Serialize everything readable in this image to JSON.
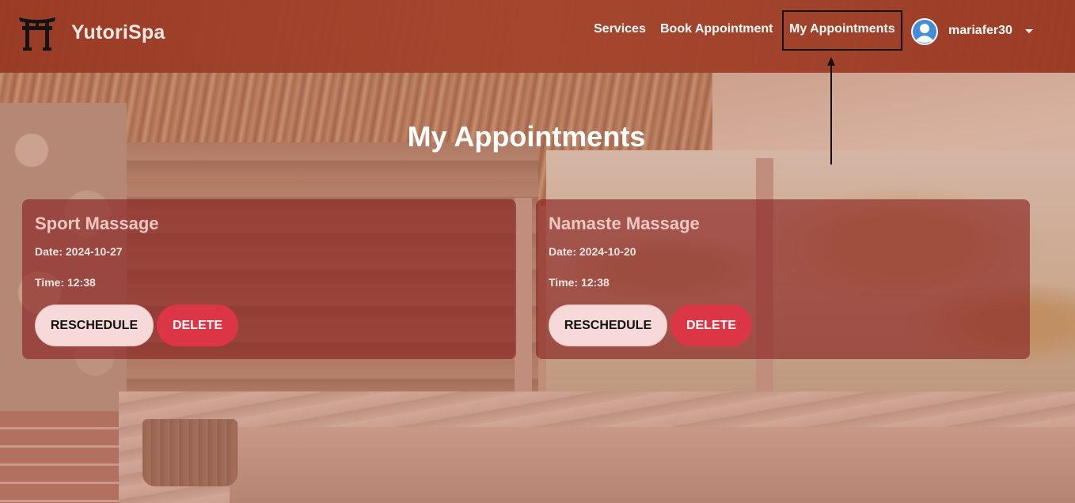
{
  "brand": {
    "name": "YutoriSpa",
    "logo_icon": "torii-gate-icon"
  },
  "nav": {
    "links": [
      {
        "label": "Services"
      },
      {
        "label": "Book Appointment"
      },
      {
        "label": "My Appointments",
        "active": true
      }
    ],
    "user": {
      "name": "mariafer30",
      "avatar_icon": "user-avatar-icon",
      "dropdown_icon": "caret-down-icon"
    }
  },
  "page": {
    "title": "My Appointments"
  },
  "appointments": [
    {
      "service": "Sport Massage",
      "date_line": "Date: 2024-10-27",
      "time_line": "Time: 12:38",
      "reschedule_label": "RESCHEDULE",
      "delete_label": "DELETE"
    },
    {
      "service": "Namaste Massage",
      "date_line": "Date: 2024-10-20",
      "time_line": "Time: 12:38",
      "reschedule_label": "RESCHEDULE",
      "delete_label": "DELETE"
    }
  ],
  "colors": {
    "navbar": "#9a3a25",
    "card": "#871e1e",
    "delete_button": "#dc3545",
    "reschedule_button": "#f7d9d9"
  }
}
